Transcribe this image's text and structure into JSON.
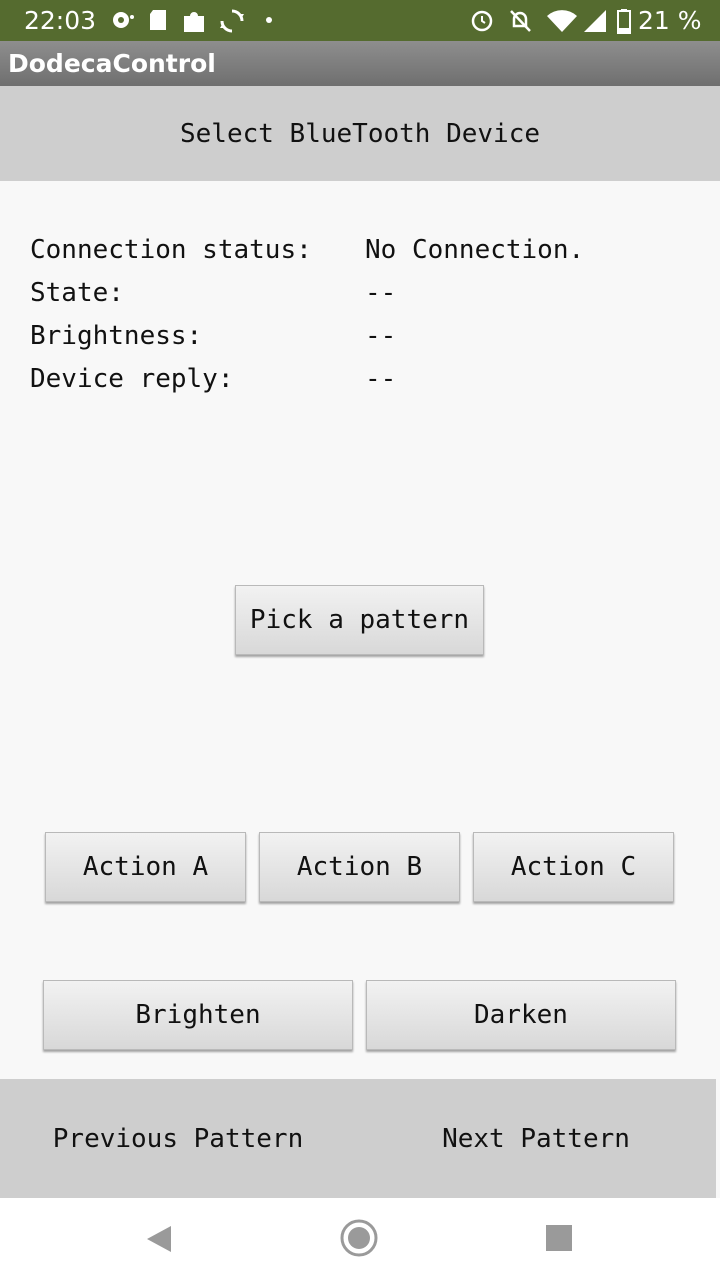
{
  "status_bar": {
    "time": "22:03",
    "battery": "21 %",
    "icons": [
      "record-icon",
      "sd-card-icon",
      "puzzle-icon",
      "sync-icon",
      "dot-icon",
      "alarm-icon",
      "notifications-off-icon",
      "wifi-icon",
      "signal-icon",
      "battery-icon"
    ]
  },
  "app": {
    "title": "DodecaControl"
  },
  "select_device": {
    "label": "Select BlueTooth Device"
  },
  "info": {
    "connection_label": "Connection status:",
    "connection_value": "No Connection.",
    "state_label": "State:",
    "state_value": "--",
    "brightness_label": "Brightness:",
    "brightness_value": "--",
    "reply_label": "Device reply:",
    "reply_value": "--"
  },
  "buttons": {
    "pick_pattern": "Pick a pattern",
    "action_a": "Action A",
    "action_b": "Action B",
    "action_c": "Action C",
    "brighten": "Brighten",
    "darken": "Darken"
  },
  "pattern_nav": {
    "previous": "Previous Pattern",
    "next": "Next Pattern"
  },
  "nav_bar": {
    "icons": [
      "back-icon",
      "home-icon",
      "recents-icon"
    ]
  },
  "colors": {
    "status_bar": "#556b2f",
    "bar_gray": "#cecece",
    "background": "#f8f8f8"
  }
}
